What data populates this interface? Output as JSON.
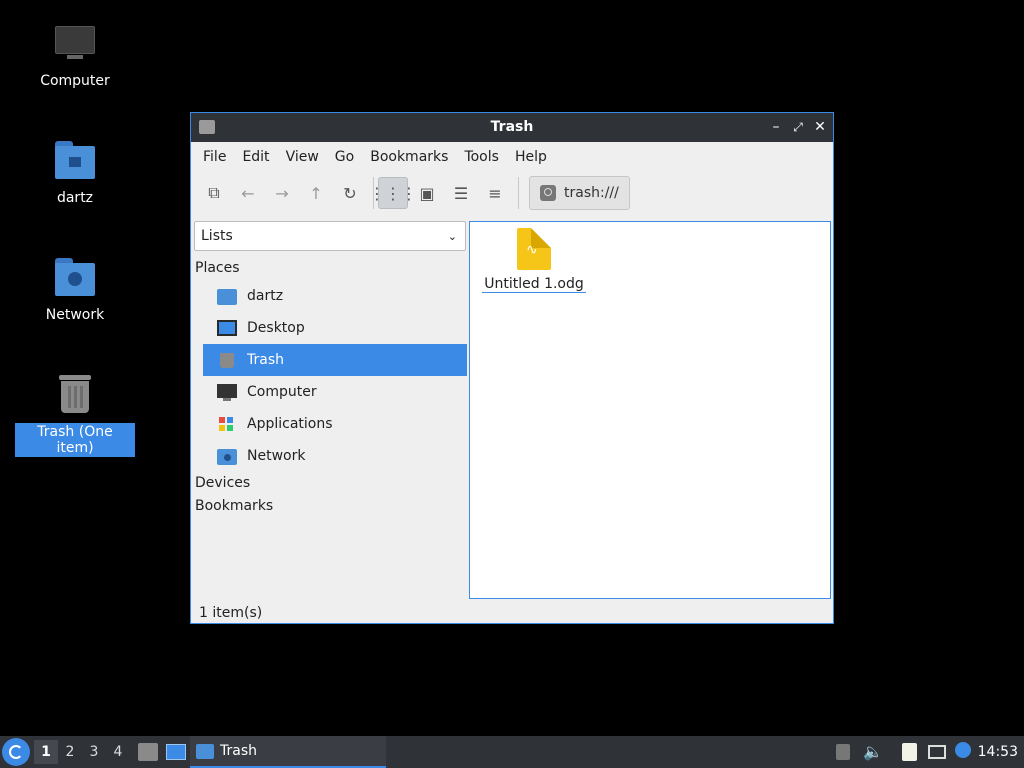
{
  "desktop": {
    "icons": [
      {
        "label": "Computer",
        "icon": "computer-icon"
      },
      {
        "label": "dartz",
        "icon": "home-folder-icon"
      },
      {
        "label": "Network",
        "icon": "network-folder-icon"
      },
      {
        "label": "Trash (One item)",
        "icon": "trash-icon"
      }
    ]
  },
  "window": {
    "title": "Trash",
    "menu": [
      "File",
      "Edit",
      "View",
      "Go",
      "Bookmarks",
      "Tools",
      "Help"
    ],
    "path": "trash:///",
    "side_selector": "Lists",
    "sections": {
      "places": "Places",
      "devices": "Devices",
      "bookmarks": "Bookmarks"
    },
    "places": [
      {
        "label": "dartz",
        "icon": "home-folder-icon"
      },
      {
        "label": "Desktop",
        "icon": "desktop-icon"
      },
      {
        "label": "Trash",
        "icon": "trash-icon"
      },
      {
        "label": "Computer",
        "icon": "computer-icon"
      },
      {
        "label": "Applications",
        "icon": "applications-icon"
      },
      {
        "label": "Network",
        "icon": "network-folder-icon"
      }
    ],
    "files": [
      {
        "name": "Untitled 1.odg",
        "icon": "draw-document-icon"
      }
    ],
    "status": "1 item(s)"
  },
  "taskbar": {
    "workspaces": [
      "1",
      "2",
      "3",
      "4"
    ],
    "task": "Trash",
    "clock": "14:53"
  },
  "colors": {
    "accent": "#3b8ae6",
    "panel": "#2f3237",
    "folder": "#4a90d9",
    "file": "#f5c518"
  }
}
